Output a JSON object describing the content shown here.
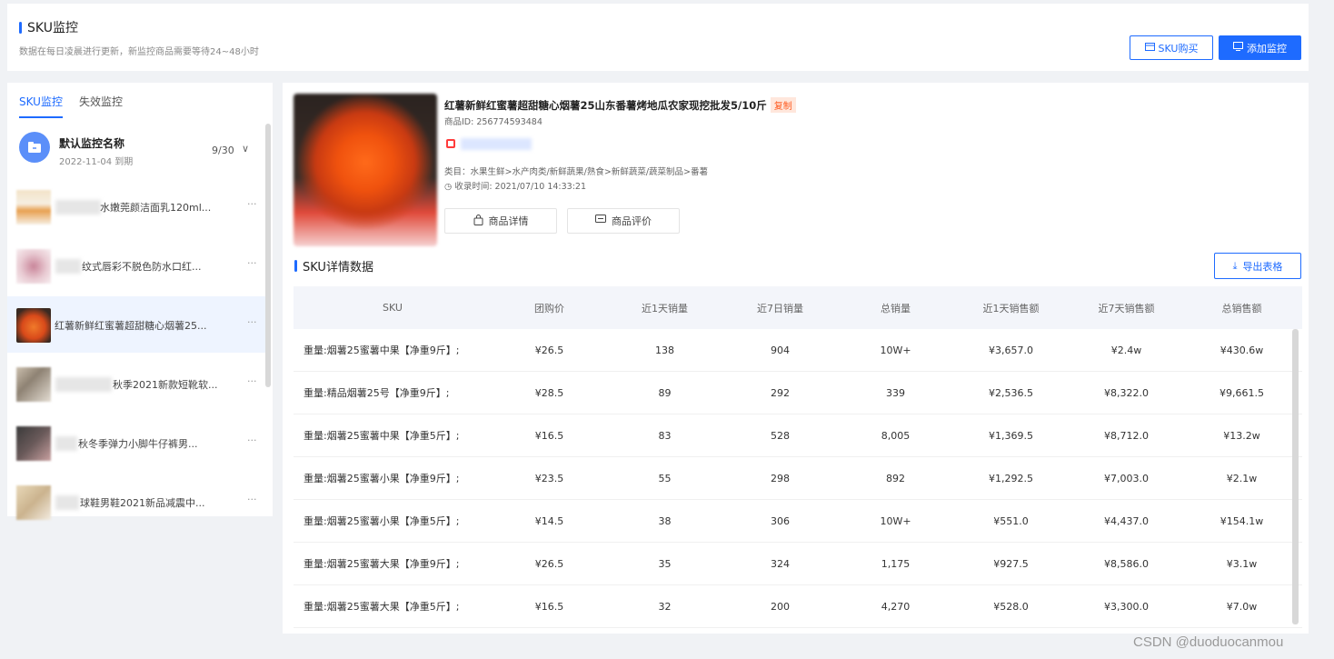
{
  "header": {
    "title": "SKU监控",
    "subtitle": "数据在每日凌晨进行更新，新监控商品需要等待24~48小时",
    "buy_label": "SKU购买",
    "add_label": "添加监控"
  },
  "sidebar": {
    "tabs": [
      {
        "label": "SKU监控",
        "active": true
      },
      {
        "label": "失效监控",
        "active": false
      }
    ],
    "group": {
      "name": "默认监控名称",
      "date": "2022-11-04 到期",
      "count": "9/30"
    },
    "items": [
      {
        "label": "水嫩莞颜洁面乳120ml...",
        "more": "···"
      },
      {
        "label": "纹式唇彩不脱色防水口红...",
        "more": "···"
      },
      {
        "label": "红薯新鲜红蜜薯超甜糖心烟薯25...",
        "more": "···"
      },
      {
        "label": "秋季2021新款短靴软...",
        "more": "···"
      },
      {
        "label": "秋冬季弹力小脚牛仔裤男...",
        "more": "···"
      },
      {
        "label": "球鞋男鞋2021新品减震中...",
        "more": "···"
      }
    ]
  },
  "product": {
    "title": "红薯新鲜红蜜薯超甜糖心烟薯25山东番薯烤地瓜农家现挖批发5/10斤",
    "copy_label": "复制",
    "id_text": "商品ID: 256774593484",
    "category_text": "类目：水果生鲜>水产肉类/新鲜蔬果/熟食>新鲜蔬菜/蔬菜制品>番薯",
    "time_text": "收录时间: 2021/07/10 14:33:21",
    "detail_label": "商品详情",
    "review_label": "商品评价"
  },
  "sku_section": {
    "title": "SKU详情数据",
    "export_label": "导出表格",
    "columns": [
      "SKU",
      "团购价",
      "近1天销量",
      "近7日销量",
      "总销量",
      "近1天销售额",
      "近7天销售额",
      "总销售额"
    ],
    "rows": [
      [
        "重量:烟薯25蜜薯中果【净重9斤】;",
        "¥26.5",
        "138",
        "904",
        "10W+",
        "¥3,657.0",
        "¥2.4w",
        "¥430.6w"
      ],
      [
        "重量:精品烟薯25号【净重9斤】;",
        "¥28.5",
        "89",
        "292",
        "339",
        "¥2,536.5",
        "¥8,322.0",
        "¥9,661.5"
      ],
      [
        "重量:烟薯25蜜薯中果【净重5斤】;",
        "¥16.5",
        "83",
        "528",
        "8,005",
        "¥1,369.5",
        "¥8,712.0",
        "¥13.2w"
      ],
      [
        "重量:烟薯25蜜薯小果【净重9斤】;",
        "¥23.5",
        "55",
        "298",
        "892",
        "¥1,292.5",
        "¥7,003.0",
        "¥2.1w"
      ],
      [
        "重量:烟薯25蜜薯小果【净重5斤】;",
        "¥14.5",
        "38",
        "306",
        "10W+",
        "¥551.0",
        "¥4,437.0",
        "¥154.1w"
      ],
      [
        "重量:烟薯25蜜薯大果【净重9斤】;",
        "¥26.5",
        "35",
        "324",
        "1,175",
        "¥927.5",
        "¥8,586.0",
        "¥3.1w"
      ],
      [
        "重量:烟薯25蜜薯大果【净重5斤】;",
        "¥16.5",
        "32",
        "200",
        "4,270",
        "¥528.0",
        "¥3,300.0",
        "¥7.0w"
      ]
    ]
  },
  "watermark": "CSDN @duoduocanmou",
  "colors": {
    "accent": "#1e6bff",
    "tag_bg": "#ffe7dc",
    "tag_text": "#ff5a1f"
  }
}
